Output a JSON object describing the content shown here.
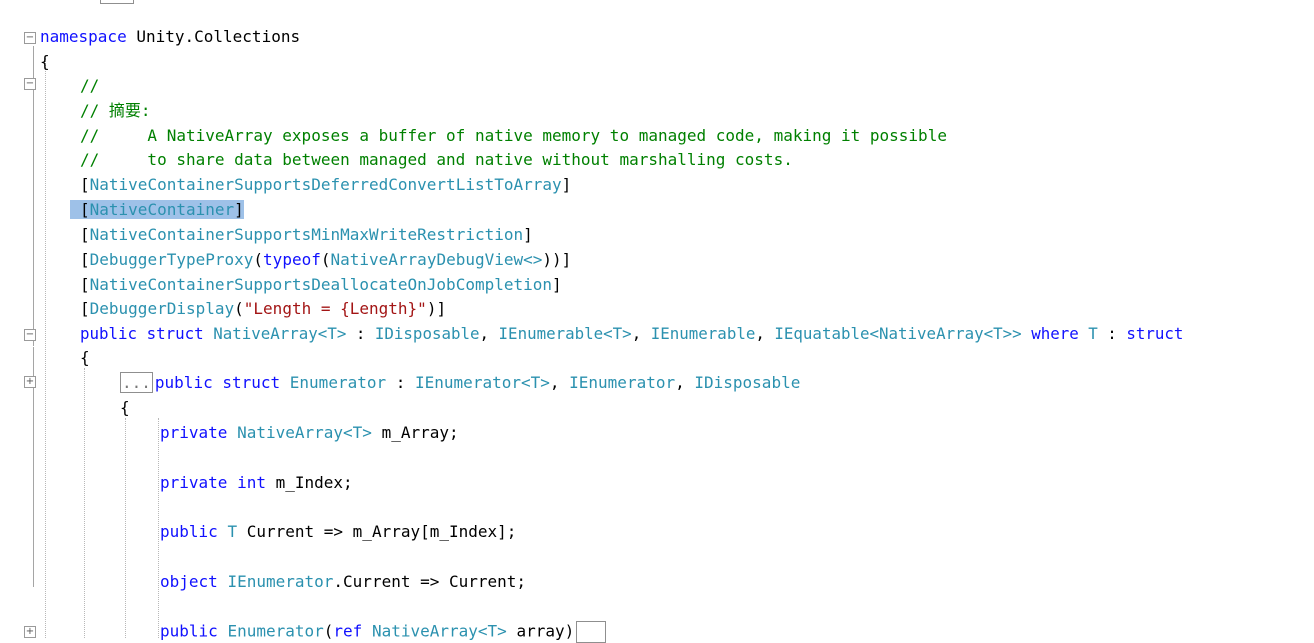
{
  "code": {
    "l1": {
      "kw": "namespace",
      "name": " Unity.Collections"
    },
    "l2": "{",
    "l3": "//",
    "l4": {
      "slashes": "// ",
      "zh": "摘要",
      "colon": ":"
    },
    "l5": "//     A NativeArray exposes a buffer of native memory to managed code, making it possible",
    "l6": "//     to share data between managed and native without marshalling costs.",
    "l7": {
      "open": "[",
      "name": "NativeContainerSupportsDeferredConvertListToArray",
      "close": "]"
    },
    "l8": {
      "open": "[",
      "name": "NativeContainer",
      "close": "]"
    },
    "l9": {
      "open": "[",
      "name": "NativeContainerSupportsMinMaxWriteRestriction",
      "close": "]"
    },
    "l10": {
      "open": "[",
      "name": "DebuggerTypeProxy",
      "p1": "(",
      "kw": "typeof",
      "p2": "(",
      "ty": "NativeArrayDebugView<>",
      "close": "))]"
    },
    "l11": {
      "open": "[",
      "name": "NativeContainerSupportsDeallocateOnJobCompletion",
      "close": "]"
    },
    "l12": {
      "open": "[",
      "name": "DebuggerDisplay",
      "p1": "(",
      "str": "\"Length = {Length}\"",
      "close": ")]"
    },
    "l13": {
      "kw1": "public",
      "kw2": "struct",
      "t1": "NativeArray<T>",
      "c1": " : ",
      "t2": "IDisposable",
      "c2": ", ",
      "t3": "IEnumerable<T>",
      "c3": ", ",
      "t4": "IEnumerable",
      "c4": ", ",
      "t5": "IEquatable<NativeArray<T>>",
      "kw3": "where",
      "t6": "T",
      "c5": " : ",
      "kw4": "struct"
    },
    "l14": "{",
    "l15": {
      "collapsed": "...",
      "kw1": "public",
      "kw2": "struct",
      "t1": "Enumerator",
      "c1": " : ",
      "t2": "IEnumerator<T>",
      "c2": ", ",
      "t3": "IEnumerator",
      "c3": ", ",
      "t4": "IDisposable"
    },
    "l16": "{",
    "l17": {
      "kw": "private",
      "ty": "NativeArray<T>",
      "rest": " m_Array;"
    },
    "l18": {
      "kw1": "private",
      "kw2": "int",
      "rest": " m_Index;"
    },
    "l19": {
      "kw": "public",
      "ty": "T",
      "rest": " Current => m_Array[m_Index];"
    },
    "l20": {
      "kw": "object",
      "ty": "IEnumerator",
      "rest": ".Current => Current;"
    },
    "l21": {
      "kw1": "public",
      "ty1": "Enumerator",
      "p1": "(",
      "kw2": "ref",
      "ty2": "NativeArray<T>",
      "rest": " array)"
    }
  },
  "colors": {
    "keyword": "#1010ff",
    "type": "#2b91af",
    "comment": "#008000",
    "string": "#a31515",
    "selection": "#9ec1e8"
  }
}
